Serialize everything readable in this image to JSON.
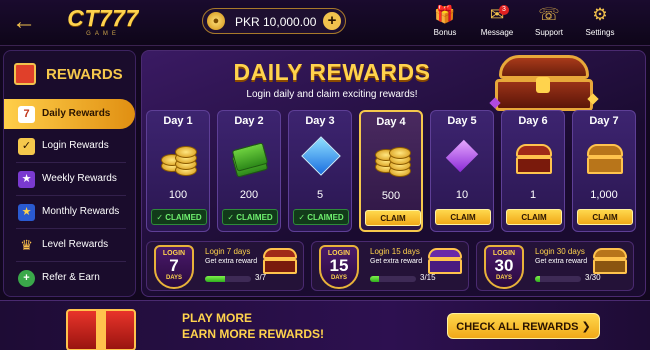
{
  "header": {
    "back_icon": "arrow-left-icon",
    "logo_main": "CT777",
    "logo_sub": "GAME",
    "balance": "PKR 10,000.00",
    "nav": [
      {
        "label": "Bonus",
        "icon": "gift-icon"
      },
      {
        "label": "Message",
        "icon": "envelope-icon",
        "badge": "3"
      },
      {
        "label": "Support",
        "icon": "headset-icon"
      },
      {
        "label": "Settings",
        "icon": "gear-icon"
      }
    ]
  },
  "sidebar": {
    "title": "REWARDS",
    "items": [
      {
        "label": "Daily Rewards",
        "icon": "calendar-icon",
        "glyph": "7",
        "active": true
      },
      {
        "label": "Login Rewards",
        "icon": "checklist-icon",
        "glyph": "✓"
      },
      {
        "label": "Weekly Rewards",
        "icon": "star-badge-icon",
        "glyph": "★"
      },
      {
        "label": "Monthly Rewards",
        "icon": "shield-star-icon",
        "glyph": "★"
      },
      {
        "label": "Level Rewards",
        "icon": "trophy-icon",
        "glyph": "♛"
      },
      {
        "label": "Refer & Earn",
        "icon": "user-plus-icon",
        "glyph": "+"
      }
    ]
  },
  "main": {
    "title": "DAILY REWARDS",
    "subtitle": "Login daily and claim exciting rewards!",
    "days": [
      {
        "label": "Day 1",
        "amount": "100",
        "status": "✓ CLAIMED",
        "claimed": true,
        "art": "coins"
      },
      {
        "label": "Day 2",
        "amount": "200",
        "status": "✓ CLAIMED",
        "claimed": true,
        "art": "cash"
      },
      {
        "label": "Day 3",
        "amount": "5",
        "status": "✓ CLAIMED",
        "claimed": true,
        "art": "diamond"
      },
      {
        "label": "Day 4",
        "amount": "500",
        "status": "CLAIM",
        "claimed": false,
        "art": "coins"
      },
      {
        "label": "Day 5",
        "amount": "10",
        "status": "CLAIM",
        "claimed": false,
        "art": "gem"
      },
      {
        "label": "Day 6",
        "amount": "1",
        "status": "CLAIM",
        "claimed": false,
        "art": "chest"
      },
      {
        "label": "Day 7",
        "amount": "1,000",
        "status": "CLAIM",
        "claimed": false,
        "art": "chest-gold"
      }
    ],
    "milestones": [
      {
        "badge_top": "LOGIN",
        "badge_num": "7",
        "badge_bottom": "DAYS",
        "title": "Login 7 days",
        "subtitle": "Get extra reward",
        "progress": "3/7",
        "fraction": 0.43,
        "chest_color": "#a02a18"
      },
      {
        "badge_top": "LOGIN",
        "badge_num": "15",
        "badge_bottom": "DAYS",
        "title": "Login 15 days",
        "subtitle": "Get extra reward",
        "progress": "3/15",
        "fraction": 0.2,
        "chest_color": "#6a2aa8"
      },
      {
        "badge_top": "LOGIN",
        "badge_num": "30",
        "badge_bottom": "DAYS",
        "title": "Login 30 days",
        "subtitle": "Get extra reward",
        "progress": "3/30",
        "fraction": 0.1,
        "chest_color": "#b8751a"
      }
    ]
  },
  "footer": {
    "line1": "PLAY MORE",
    "line2": "EARN MORE REWARDS!",
    "cta": "CHECK ALL REWARDS ❯"
  },
  "colors": {
    "accent_gold": "#f5c84c",
    "claimed_green": "#6ff06f",
    "bg": "#12071f"
  }
}
